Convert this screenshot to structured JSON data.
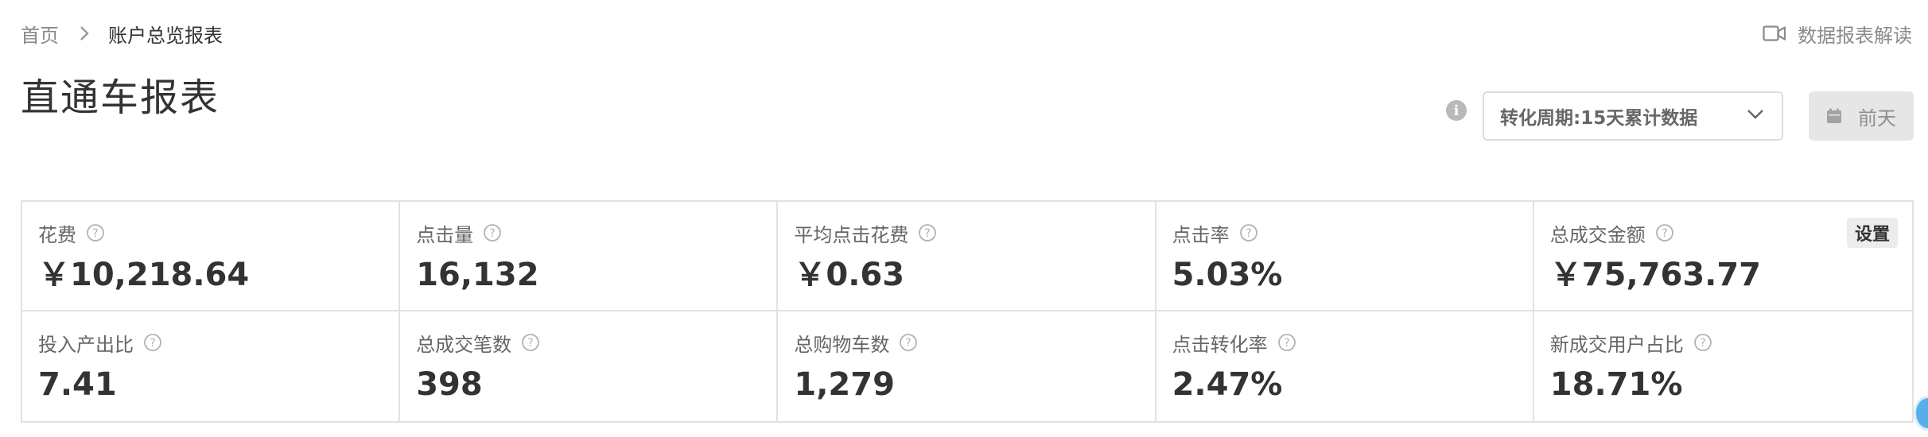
{
  "breadcrumb": {
    "home": "首页",
    "current": "账户总览报表"
  },
  "help_link": {
    "label": "数据报表解读",
    "icon": "video-icon"
  },
  "page_title": "直通车报表",
  "filters": {
    "info_icon": "info-icon",
    "period_select_value": "转化周期:15天累计数据",
    "date_button_label": "前天"
  },
  "metrics": [
    {
      "label": "花费",
      "value": "￥10,218.64"
    },
    {
      "label": "点击量",
      "value": "16,132"
    },
    {
      "label": "平均点击花费",
      "value": "￥0.63"
    },
    {
      "label": "点击率",
      "value": "5.03%"
    },
    {
      "label": "总成交金额",
      "value": "￥75,763.77"
    },
    {
      "label": "投入产出比",
      "value": "7.41"
    },
    {
      "label": "总成交笔数",
      "value": "398"
    },
    {
      "label": "总购物车数",
      "value": "1,279"
    },
    {
      "label": "点击转化率",
      "value": "2.47%"
    },
    {
      "label": "新成交用户占比",
      "value": "18.71%"
    }
  ],
  "settings_button": "设置",
  "colors": {
    "text_primary": "#333333",
    "text_secondary": "#666666",
    "border": "#e2e2e2",
    "button_disabled_bg": "#e6e6e6",
    "floating_accent": "#58aee8"
  }
}
